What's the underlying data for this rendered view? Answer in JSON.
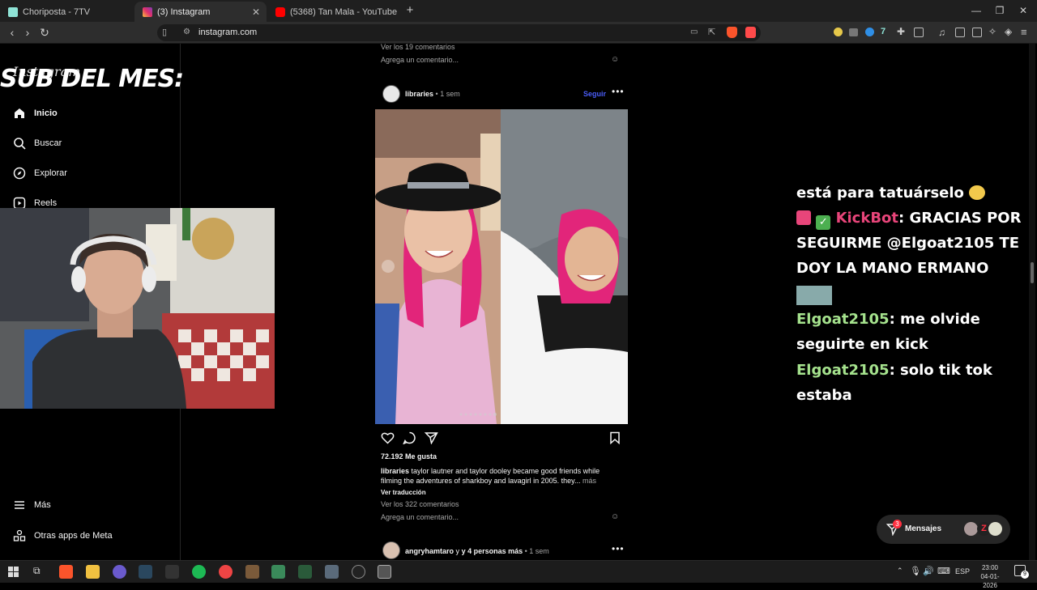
{
  "browser": {
    "tabs": [
      {
        "label": "Choriposta - 7TV"
      },
      {
        "label": "(3) Instagram"
      },
      {
        "label": "(5368) Tan Mala - YouTube"
      }
    ],
    "url": "instagram.com"
  },
  "overlay": {
    "sub_title": "SUB DEL MES:"
  },
  "sidebar": {
    "logo": "Instagram",
    "items": [
      {
        "label": "Inicio"
      },
      {
        "label": "Buscar"
      },
      {
        "label": "Explorar"
      },
      {
        "label": "Reels"
      }
    ],
    "bottom": [
      {
        "label": "Más"
      },
      {
        "label": "Otras apps de Meta"
      }
    ]
  },
  "prev_post": {
    "comments_link": "Ver los 19 comentarios",
    "comment_placeholder": "Agrega un comentario..."
  },
  "post": {
    "username": "libraries",
    "time": "• 1 sem",
    "follow": "Seguir",
    "likes": "72.192 Me gusta",
    "caption_user": "libraries",
    "caption_text": "taylor lautner and taylor dooley became good friends while filming the adventures of sharkboy and lavagirl in 2005. they...",
    "more": "más",
    "translation": "Ver traducción",
    "comments_link": "Ver los 322 comentarios",
    "comment_placeholder": "Agrega un comentario..."
  },
  "next_post": {
    "username": "angryhamtaro",
    "others": "y 4 personas más",
    "time": "• 1 sem"
  },
  "messages": {
    "label": "Mensajes",
    "badge": "3"
  },
  "chat": {
    "lines": {
      "l1": "está para tatuárselo",
      "bot_name": "KickBot",
      "bot_msg": ": GRACIAS POR",
      "l3": "SEGUIRME @Elgoat2105 TE",
      "l4": "DOY LA MANO ERMANO",
      "u1": "Elgoat2105",
      "m1": ": me olvide",
      "l6": "seguirte en kick",
      "u2": "Elgoat2105",
      "m2": ": solo tik tok",
      "l8": "estaba"
    }
  },
  "taskbar": {
    "lang": "ESP",
    "time": "23:00",
    "date": "04-01-2026",
    "notif": "9"
  },
  "colors": {
    "accent": "#4a5df9",
    "chat_user": "#a5e28d",
    "kickbot": "#e8457a"
  }
}
